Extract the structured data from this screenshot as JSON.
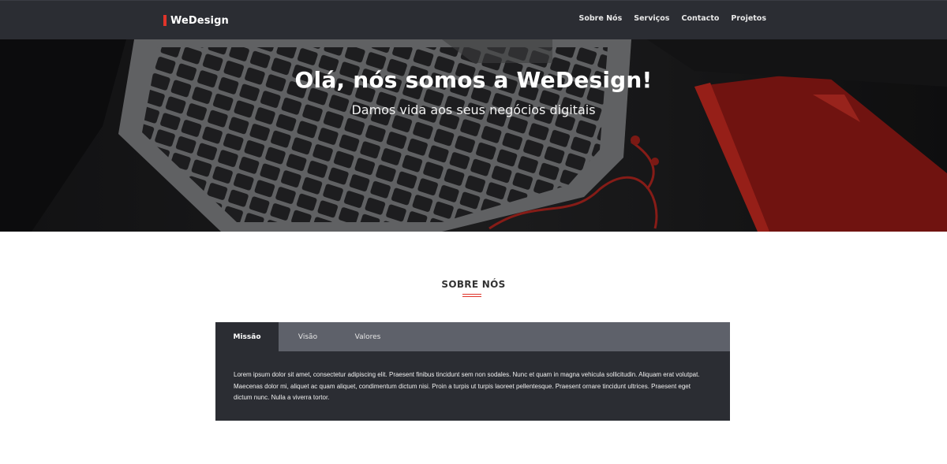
{
  "nav": {
    "brand": "WeDesign",
    "links": [
      "Sobre Nós",
      "Serviços",
      "Contacto",
      "Projetos"
    ]
  },
  "hero": {
    "title": "Olá, nós somos a WeDesign!",
    "subtitle": "Damos vida aos seus negócios digitais"
  },
  "about": {
    "title": "SOBRE NÓS",
    "tabs": [
      "Missão",
      "Visão",
      "Valores"
    ],
    "active_tab": "Missão",
    "content": "Lorem ipsum dolor sit amet, consectetur adipiscing elit. Praesent finibus tincidunt sem non sodales. Nunc et quam in magna vehicula sollicitudin. Aliquam erat volutpat. Maecenas dolor mi, aliquet ac quam aliquet, condimentum dictum nisi. Proin a turpis ut turpis laoreet pellentesque. Praesent ornare tincidunt ultrices. Praesent eget dictum nunc. Nulla a viverra tortor."
  },
  "colors": {
    "accent": "#e0342a",
    "navbar": "#2b2d33",
    "tab_bar": "#5e616a"
  }
}
